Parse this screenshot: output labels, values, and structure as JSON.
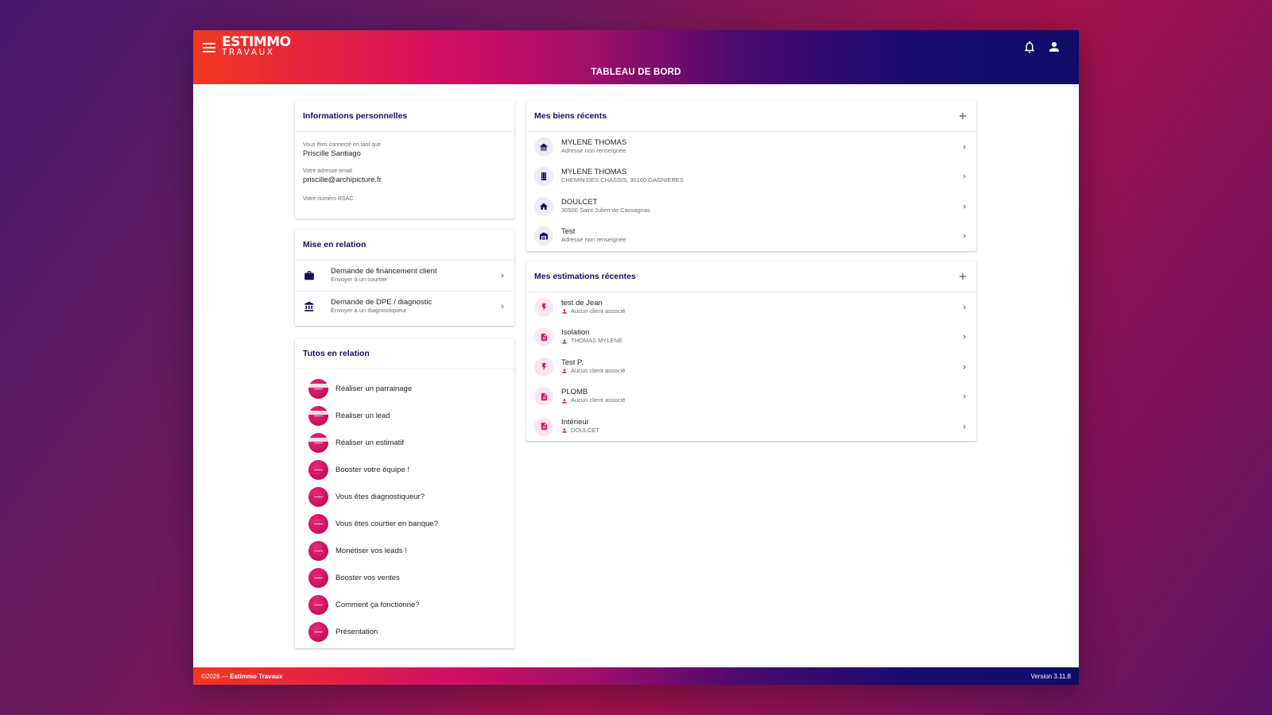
{
  "header": {
    "logo_line1": "ESTIMMO",
    "logo_line2": "TRAVAUX",
    "title": "TABLEAU DE BORD"
  },
  "personal_info": {
    "title": "Informations personnelles",
    "connected_label": "Vous êtes connecté en tant que",
    "connected_value": "Priscille Santiago",
    "email_label": "Votre adresse email",
    "email_value": "priscille@archipicture.fr",
    "rsac_label": "Votre numéro RSAC"
  },
  "relation": {
    "title": "Mise en relation",
    "items": [
      {
        "primary": "Demande de financement client",
        "secondary": "Envoyer à un courtier",
        "icon": "briefcase-icon"
      },
      {
        "primary": "Demande de DPE / diagnostic",
        "secondary": "Envoyer à un diagnostiqueur",
        "icon": "bank-icon"
      }
    ]
  },
  "tutos": {
    "title": "Tutos en relation",
    "items": [
      "Réaliser un parrainage",
      "Réaliser un lead",
      "Réaliser un estimatif",
      "Booster votre équipe !",
      "Vous êtes diagnostiqueur?",
      "Vous êtes courtier en banque?",
      "Monétiser vos leads !",
      "Booster vos ventes",
      "Comment ça fonctionne?",
      "Présentation"
    ]
  },
  "biens": {
    "title": "Mes biens récents",
    "items": [
      {
        "primary": "MYLENE THOMAS",
        "secondary": "Adresse non renseignée",
        "icon": "house-garage-icon"
      },
      {
        "primary": "MYLENE THOMAS",
        "secondary": "CHEMIN DES CHASSIS, 30160 GAGNIERES",
        "icon": "building-icon"
      },
      {
        "primary": "DOULCET",
        "secondary": "30500 Saint Julien de Cassagnas",
        "icon": "home-icon"
      },
      {
        "primary": "Test",
        "secondary": "Adresse non renseignée",
        "icon": "warehouse-icon"
      }
    ]
  },
  "estimations": {
    "title": "Mes estimations récentes",
    "items": [
      {
        "primary": "test de Jean",
        "secondary": "Aucun client associé",
        "icon": "lightning-icon"
      },
      {
        "primary": "Isolation",
        "secondary": "THOMAS MYLENE",
        "icon": "document-icon"
      },
      {
        "primary": "Test P.",
        "secondary": "Aucun client associé",
        "icon": "lightning-icon"
      },
      {
        "primary": "PLOMB",
        "secondary": "Aucun client associé",
        "icon": "document-icon"
      },
      {
        "primary": "Intérieur",
        "secondary": "DOULCET",
        "icon": "document-icon"
      }
    ]
  },
  "footer": {
    "copyright": "©2026 — ",
    "company": "Estimmo Travaux",
    "version": "Version 3.11.8"
  },
  "colors": {
    "navy": "#150f5c",
    "pink": "#d0176a",
    "gradient_start": "#f2381f",
    "gradient_end": "#0f0c68"
  }
}
